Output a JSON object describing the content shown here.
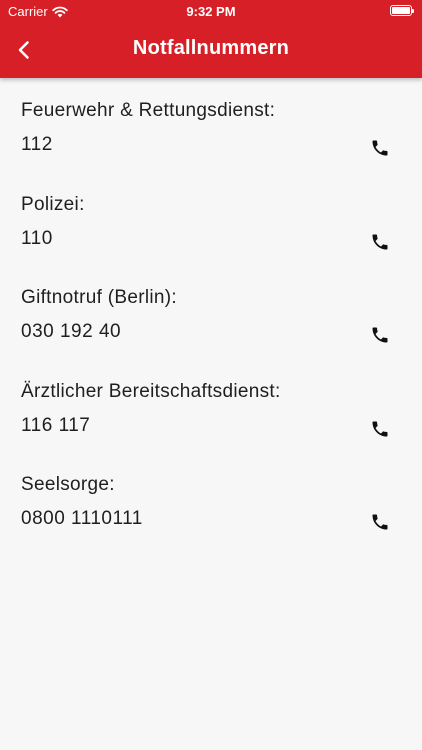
{
  "status_bar": {
    "carrier": "Carrier",
    "time": "9:32 PM"
  },
  "header": {
    "title": "Notfallnummern",
    "back_icon": "chevron-left-icon"
  },
  "colors": {
    "accent": "#d71f27",
    "background": "#f7f7f7",
    "text": "#1f1f1f"
  },
  "entries": [
    {
      "label": "Feuerwehr & Rettungsdienst:",
      "number": "112",
      "icon": "phone-icon"
    },
    {
      "label": "Polizei:",
      "number": "110",
      "icon": "phone-icon"
    },
    {
      "label": "Giftnotruf (Berlin):",
      "number": "030 192 40",
      "icon": "phone-icon"
    },
    {
      "label": "Ärztlicher Bereitschaftsdienst:",
      "number": "116 117",
      "icon": "phone-icon"
    },
    {
      "label": "Seelsorge:",
      "number": "0800 1110111",
      "icon": "phone-icon"
    }
  ]
}
